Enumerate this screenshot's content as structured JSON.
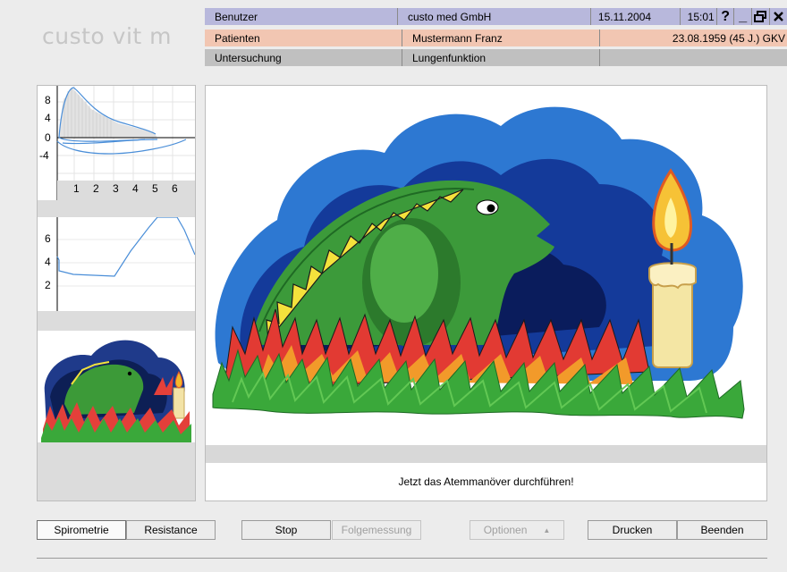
{
  "app": {
    "logo": "custo vit m"
  },
  "header": {
    "user_label": "Benutzer",
    "user_value": "custo med GmbH",
    "date": "15.11.2004",
    "time": "15:01",
    "help_icon": "?",
    "minimize_icon": "_",
    "restore_icon": "restore-icon",
    "close_icon": "close-icon",
    "patient_label": "Patienten",
    "patient_value": "Mustermann Franz",
    "patient_dob": "23.08.1959 (45 J.) GKV",
    "exam_label": "Untersuchung",
    "exam_value": "Lungenfunktion"
  },
  "plots": {
    "flow_volume": {
      "y_ticks": [
        "8",
        "4",
        "0",
        "-4"
      ],
      "x_ticks": [
        "1",
        "2",
        "3",
        "4",
        "5",
        "6"
      ]
    },
    "volume_time": {
      "y_ticks": [
        "6",
        "4",
        "2"
      ]
    }
  },
  "main": {
    "message": "Jetzt das Atemmanöver durchführen!"
  },
  "buttons": {
    "spirometrie": "Spirometrie",
    "resistance": "Resistance",
    "stop": "Stop",
    "folgemessung": "Folgemessung",
    "optionen": "Optionen",
    "drucken": "Drucken",
    "beenden": "Beenden"
  },
  "colors": {
    "header_user_bg": "#b8b8dc",
    "header_patient_bg": "#f2c6b2",
    "header_exam_bg": "#c0c0c0",
    "curve": "#4a8ed8"
  }
}
